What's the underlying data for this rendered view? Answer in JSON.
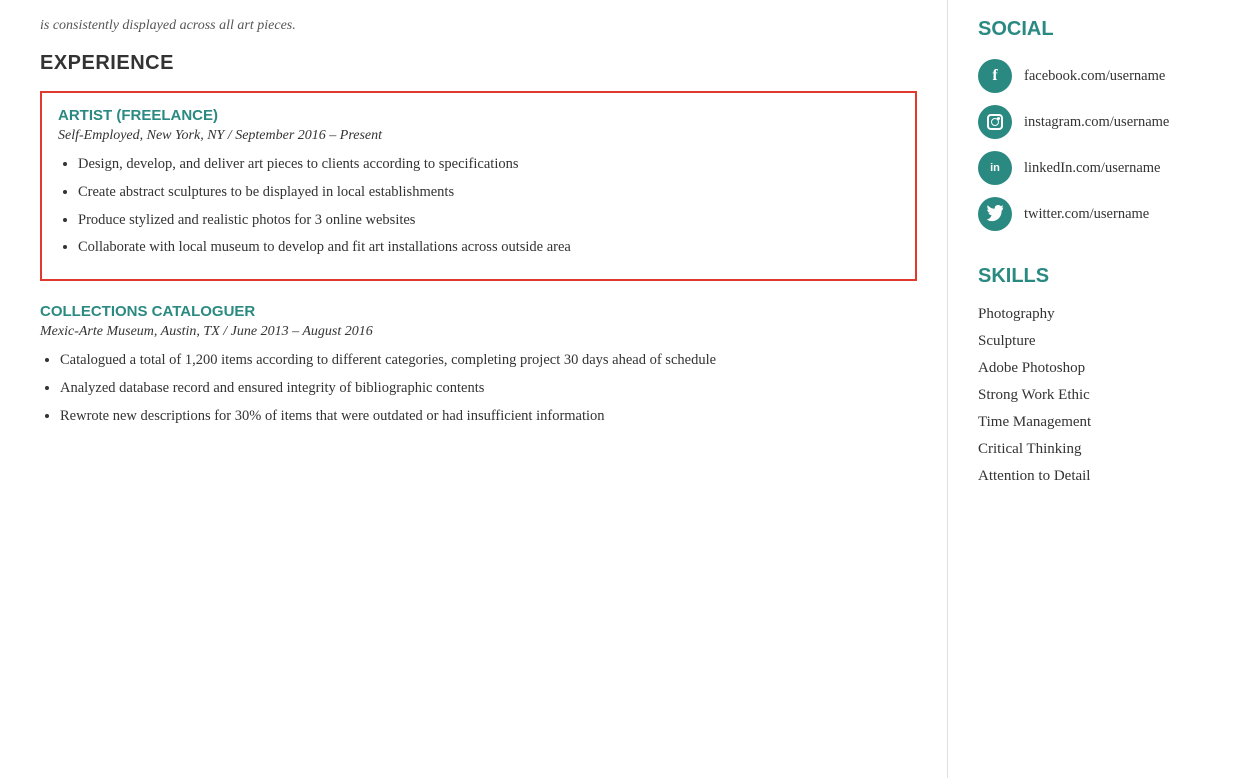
{
  "left": {
    "top_text": "is consistently displayed across all art pieces.",
    "experience_heading": "EXPERIENCE",
    "jobs": [
      {
        "id": "freelance",
        "title": "ARTIST (FREELANCE)",
        "subtitle": "Self-Employed, New York, NY  /  September 2016 – Present",
        "highlighted": true,
        "bullets": [
          "Design, develop, and deliver art pieces to clients according to specifications",
          "Create abstract sculptures to be displayed in local establishments",
          "Produce stylized and realistic photos for 3 online websites",
          "Collaborate with local museum to develop and fit art installations across outside area"
        ]
      },
      {
        "id": "cataloguer",
        "title": "COLLECTIONS CATALOGUER",
        "subtitle": "Mexic-Arte Museum, Austin, TX  /  June 2013 – August 2016",
        "highlighted": false,
        "bullets": [
          "Catalogued a total of 1,200 items according to different categories, completing project 30 days ahead of schedule",
          "Analyzed database record and ensured integrity of bibliographic contents",
          "Rewrote new descriptions for 30% of items that were outdated or had insufficient information"
        ]
      }
    ]
  },
  "right": {
    "social_heading": "SOCIAL",
    "social_items": [
      {
        "id": "facebook",
        "icon_label": "f",
        "text": "facebook.com/username"
      },
      {
        "id": "instagram",
        "icon_label": "instagram",
        "text": "instagram.com/username"
      },
      {
        "id": "linkedin",
        "icon_label": "in",
        "text": "linkedIn.com/username"
      },
      {
        "id": "twitter",
        "icon_label": "twitter",
        "text": "twitter.com/username"
      }
    ],
    "skills_heading": "SKILLS",
    "skills": [
      "Photography",
      "Sculpture",
      "Adobe Photoshop",
      "Strong Work Ethic",
      "Time Management",
      "Critical Thinking",
      "Attention to Detail"
    ]
  }
}
